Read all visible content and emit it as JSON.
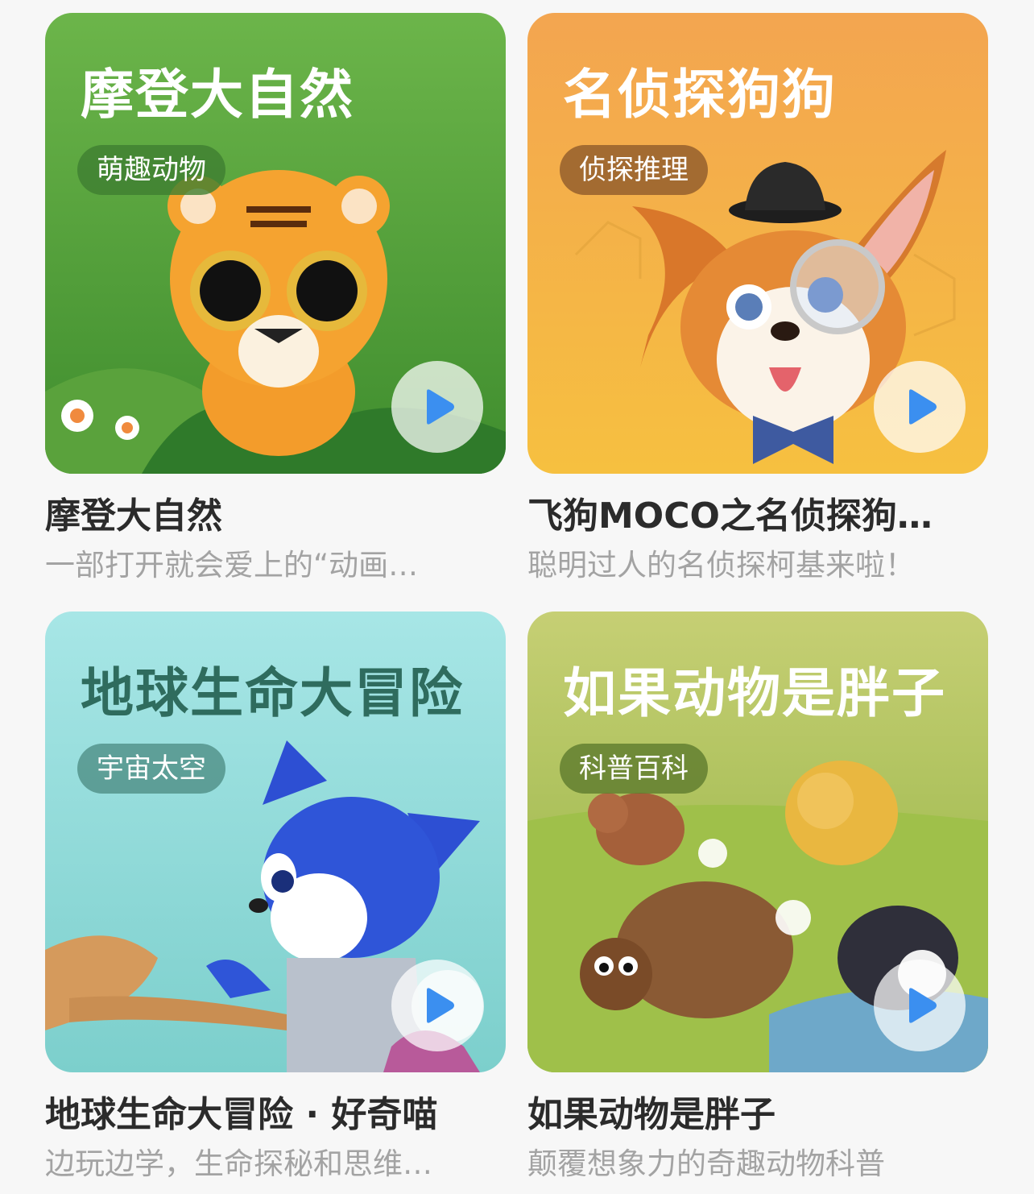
{
  "cards": [
    {
      "thumb_title": "摩登大自然",
      "tag": "萌趣动物",
      "name": "摩登大自然",
      "description": "一部打开就会爱上的“动画…",
      "colors": {
        "bg": "#5fa83e",
        "title": "#ffffff",
        "tag_bg": "#3f7e31"
      }
    },
    {
      "thumb_title": "名侦探狗狗",
      "tag": "侦探推理",
      "name": "飞狗MOCO之名侦探狗…",
      "description": "聪明过人的名侦探柯基来啦！",
      "colors": {
        "bg": "#f4a94e",
        "title": "#ffffff",
        "tag_bg": "#8e5a2b"
      }
    },
    {
      "thumb_title": "地球生命大冒险",
      "tag": "宇宙太空",
      "name": "地球生命大冒险 · 好奇喵",
      "description": "边玩边学，生命探秘和思维…",
      "colors": {
        "bg": "#8fd9d8",
        "title": "#2f6c5e",
        "tag_bg": "#4f8f86"
      }
    },
    {
      "thumb_title": "如果动物是胖子",
      "tag": "科普百科",
      "name": "如果动物是胖子",
      "description": "颠覆想象力的奇趣动物科普",
      "colors": {
        "bg": "#a8c04f",
        "title": "#ffffff",
        "tag_bg": "#5e7a2d"
      }
    }
  ],
  "icons": {
    "play": "play-icon"
  }
}
